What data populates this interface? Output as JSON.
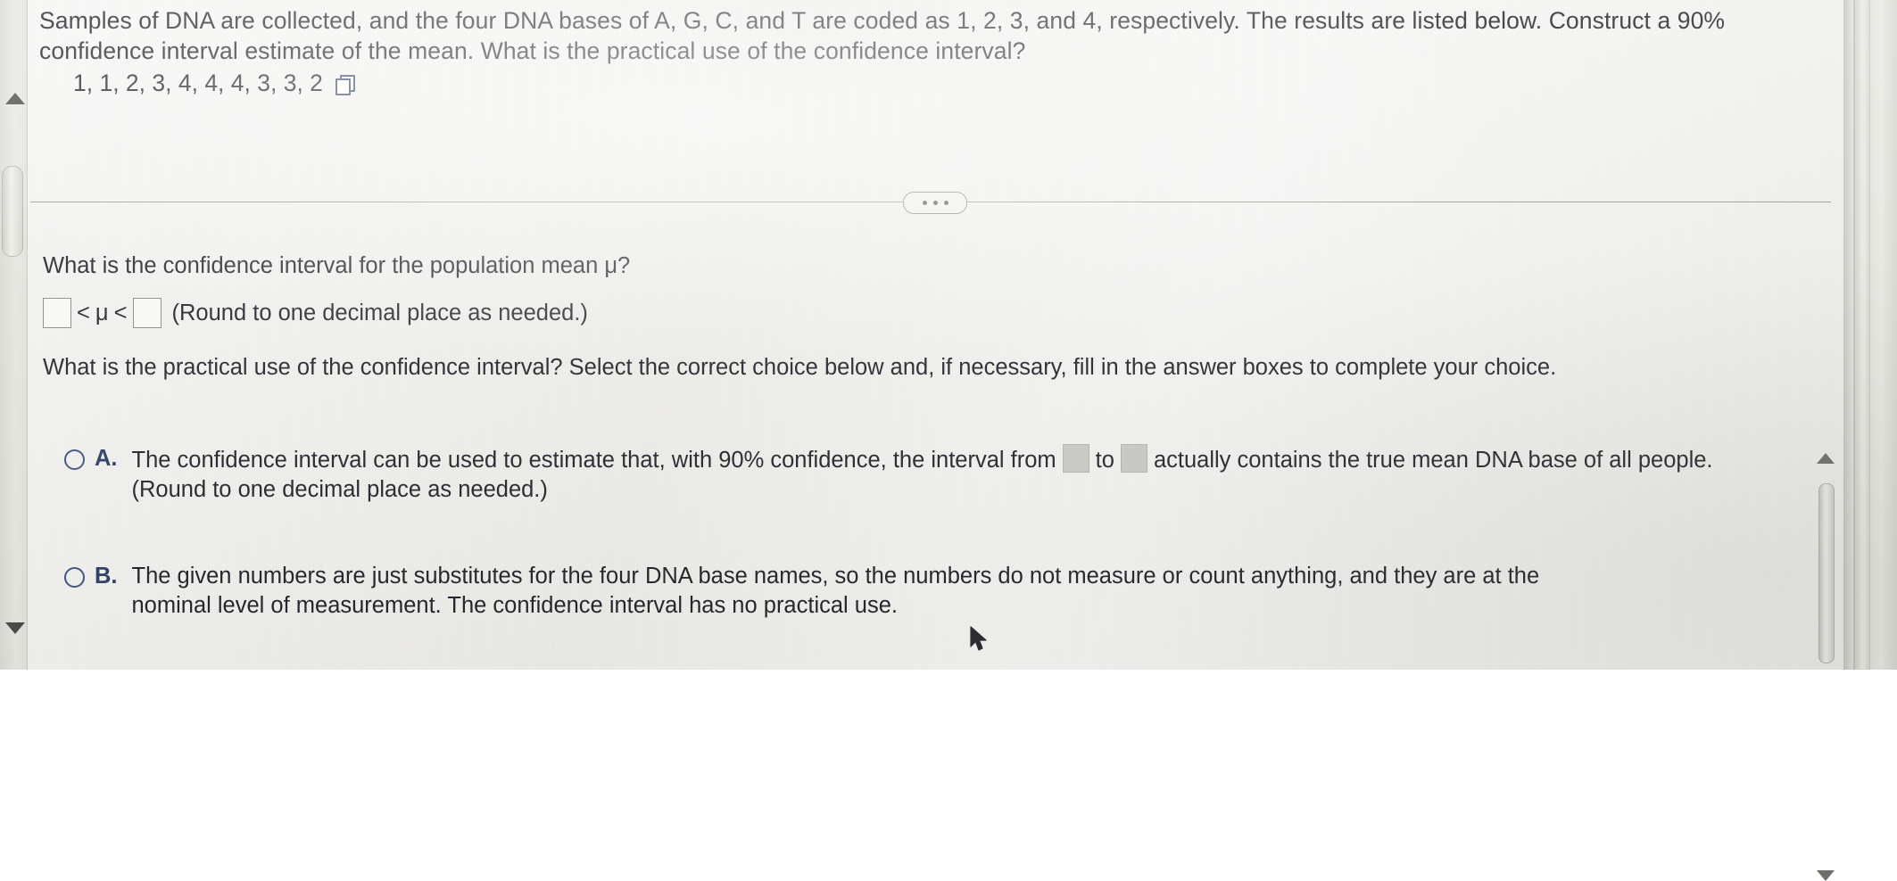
{
  "question": {
    "stem": "Samples of DNA are collected, and the four DNA bases of A, G, C, and T are coded as 1, 2, 3, and 4, respectively. The results are listed below. Construct a 90% confidence interval estimate of the mean. What is the practical use of the confidence interval?",
    "data_values": "1, 1, 2, 3, 4, 4, 4, 3, 3, 2",
    "copy_icon": "copy-icon"
  },
  "divider": {
    "more_icon": "ellipsis-icon",
    "dot_count": 3
  },
  "answer_section": {
    "prompt_interval": "What is the confidence interval for the population mean μ?",
    "interval_left_value": "",
    "interval_left_placeholder": "",
    "interval_operator_left": "<",
    "interval_symbol": "μ",
    "interval_operator_right": "<",
    "interval_right_value": "",
    "interval_right_placeholder": "",
    "rounding_hint": "(Round to one decimal place as needed.)",
    "prompt_choice": "What is the practical use of the confidence interval? Select the correct choice below and, if necessary, fill in the answer boxes to complete your choice."
  },
  "choices": [
    {
      "letter": "A.",
      "selected": false,
      "text_before_box1": "The confidence interval can be used to estimate that, with 90% confidence, the interval from",
      "box1_value": "",
      "text_between_boxes": "to",
      "box2_value": "",
      "text_after_box2": "actually contains the true mean DNA base of all people.",
      "sub_hint": "(Round to one decimal place as needed.)"
    },
    {
      "letter": "B.",
      "selected": false,
      "text_line1": "The given numbers are just substitutes for the four DNA base names, so the numbers do not measure or count anything, and they are at the",
      "text_line2": "nominal level of measurement. The confidence interval has no practical use."
    }
  ],
  "scrollbars": {
    "outer_up_icon": "triangle-up-icon",
    "outer_down_icon": "triangle-down-icon",
    "inner_up_icon": "triangle-up-icon",
    "inner_down_icon": "triangle-down-icon"
  },
  "cursor": {
    "icon": "mouse-pointer-icon"
  },
  "colors": {
    "text": "#23232b",
    "accent_blue": "#2e3f66",
    "radio_border": "#41557e",
    "box_fill": "#cbcbc7",
    "page_bg": "#efeeea"
  }
}
